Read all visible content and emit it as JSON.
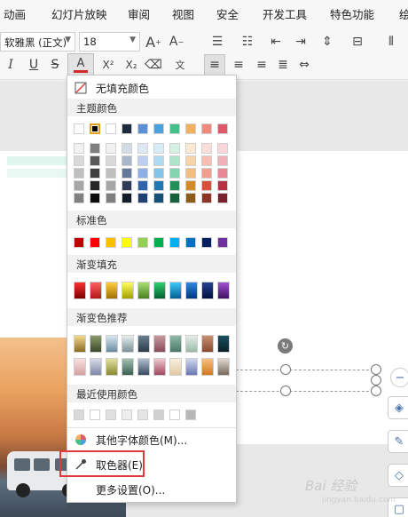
{
  "menubar": {
    "items": [
      "动画",
      "幻灯片放映",
      "审阅",
      "视图",
      "安全",
      "开发工具",
      "特色功能",
      "绘"
    ]
  },
  "toolbar": {
    "font_name": "软雅黑 (正文)",
    "font_size": "18",
    "font_color_label": "A",
    "icons": [
      "grow-font-icon",
      "shrink-font-icon",
      "bullet-list-icon",
      "numbered-list-icon",
      "indent-decrease-icon",
      "indent-increase-icon",
      "line-spacing-icon",
      "text-direction-icon",
      "italic-icon",
      "underline-icon",
      "strikethrough-icon",
      "font-color-icon",
      "superscript-icon",
      "subscript-icon",
      "clear-format-icon",
      "phonetic-icon",
      "align-left-icon",
      "align-center-icon",
      "align-right-icon",
      "justify-icon",
      "distributed-icon",
      "columns-icon"
    ],
    "accent_color": "#d22b2b"
  },
  "dropdown": {
    "no_fill": "无填充颜色",
    "theme_colors": "主题颜色",
    "standard_colors": "标准色",
    "gradient_fill": "渐变填充",
    "gradient_recommend": "渐变色推荐",
    "recent_colors": "最近使用颜色",
    "more_colors": "其他字体颜色(M)...",
    "eyedropper": "取色器(E)",
    "more_settings": "更多设置(O)...",
    "theme_top": [
      "#ffffff",
      "#000000",
      "#ffffff",
      "#1f2a3c",
      "#5b8fd6",
      "#4aa3df",
      "#44c08a",
      "#f2b15f",
      "#f08a7a",
      "#e0586a"
    ],
    "theme_shades": [
      [
        "#f2f2f2",
        "#7f7f7f",
        "#f2f2f2",
        "#d5dbe5",
        "#dde7f6",
        "#d6ecf8",
        "#d6f1e4",
        "#fbe9d2",
        "#fbdeda",
        "#f8d6da"
      ],
      [
        "#d9d9d9",
        "#595959",
        "#d9d9d9",
        "#aab7cb",
        "#bccff0",
        "#addaf1",
        "#aee4ca",
        "#f8d4a8",
        "#f8beb5",
        "#f1afb6"
      ],
      [
        "#bfbfbf",
        "#3f3f3f",
        "#bfbfbf",
        "#66789a",
        "#8eaee6",
        "#82c5ea",
        "#82d5ae",
        "#f4be7e",
        "#f49c8e",
        "#e98792"
      ],
      [
        "#a6a6a6",
        "#262626",
        "#a6a6a6",
        "#2f3a56",
        "#3163ad",
        "#1f78b4",
        "#23905c",
        "#d48b25",
        "#d4503a",
        "#b93145"
      ],
      [
        "#808080",
        "#0d0d0d",
        "#808080",
        "#141b29",
        "#203f72",
        "#145078",
        "#175f3d",
        "#8d5c18",
        "#8c3426",
        "#7b202e"
      ]
    ],
    "standard": [
      "#c00000",
      "#ff0000",
      "#ffc000",
      "#ffff00",
      "#92d050",
      "#00b050",
      "#00b0f0",
      "#0070c0",
      "#002060",
      "#7030a0"
    ],
    "gradients": [
      [
        "#7a0000",
        "#ff3030"
      ],
      [
        "#b01818",
        "#ff6060"
      ],
      [
        "#a07000",
        "#ffd040"
      ],
      [
        "#a0a000",
        "#ffff60"
      ],
      [
        "#4a8020",
        "#a8e070"
      ],
      [
        "#006030",
        "#30d070"
      ],
      [
        "#006090",
        "#40c8f8"
      ],
      [
        "#003880",
        "#3088e0"
      ],
      [
        "#001040",
        "#284090"
      ],
      [
        "#401060",
        "#a050d0"
      ]
    ],
    "recommend_row1": [
      [
        "#f5d98a",
        "#8a6a20"
      ],
      [
        "#8a9a6a",
        "#3a4a2a"
      ],
      [
        "#d8e8f0",
        "#6a8aa0"
      ],
      [
        "#e8f0f0",
        "#7a9098"
      ],
      [
        "#6a8090",
        "#2a3a48"
      ],
      [
        "#c89aa0",
        "#8a4a58"
      ],
      [
        "#90b8a8",
        "#4a7868"
      ],
      [
        "#e8f0e8",
        "#98b8a8"
      ],
      [
        "#c89070",
        "#8a4a30"
      ],
      [
        "#1a5060",
        "#0a2028"
      ]
    ],
    "recommend_row2": [
      [
        "#f8e0e0",
        "#d8a0a0"
      ],
      [
        "#d8dae8",
        "#8088a8"
      ],
      [
        "#e0e0a0",
        "#8a8a30"
      ],
      [
        "#a0c0b0",
        "#3a6050"
      ],
      [
        "#b0c0d0",
        "#3a4a60"
      ],
      [
        "#f0c8d0",
        "#a04860"
      ],
      [
        "#f8f0e0",
        "#e0c8a0"
      ],
      [
        "#d0d8f0",
        "#6878b0"
      ],
      [
        "#f8c080",
        "#d07820"
      ],
      [
        "#e0d8d0",
        "#786858"
      ]
    ],
    "recent": [
      "#d9d9d9",
      "#ffffff",
      "#e0e0e0",
      "#eeeeee",
      "#e6e6e6",
      "#cfcfcf",
      "#ffffff",
      "#b8b8b8"
    ]
  },
  "watermark": {
    "brand": "Bai 经验",
    "url": "jingyan.baidu.com"
  }
}
